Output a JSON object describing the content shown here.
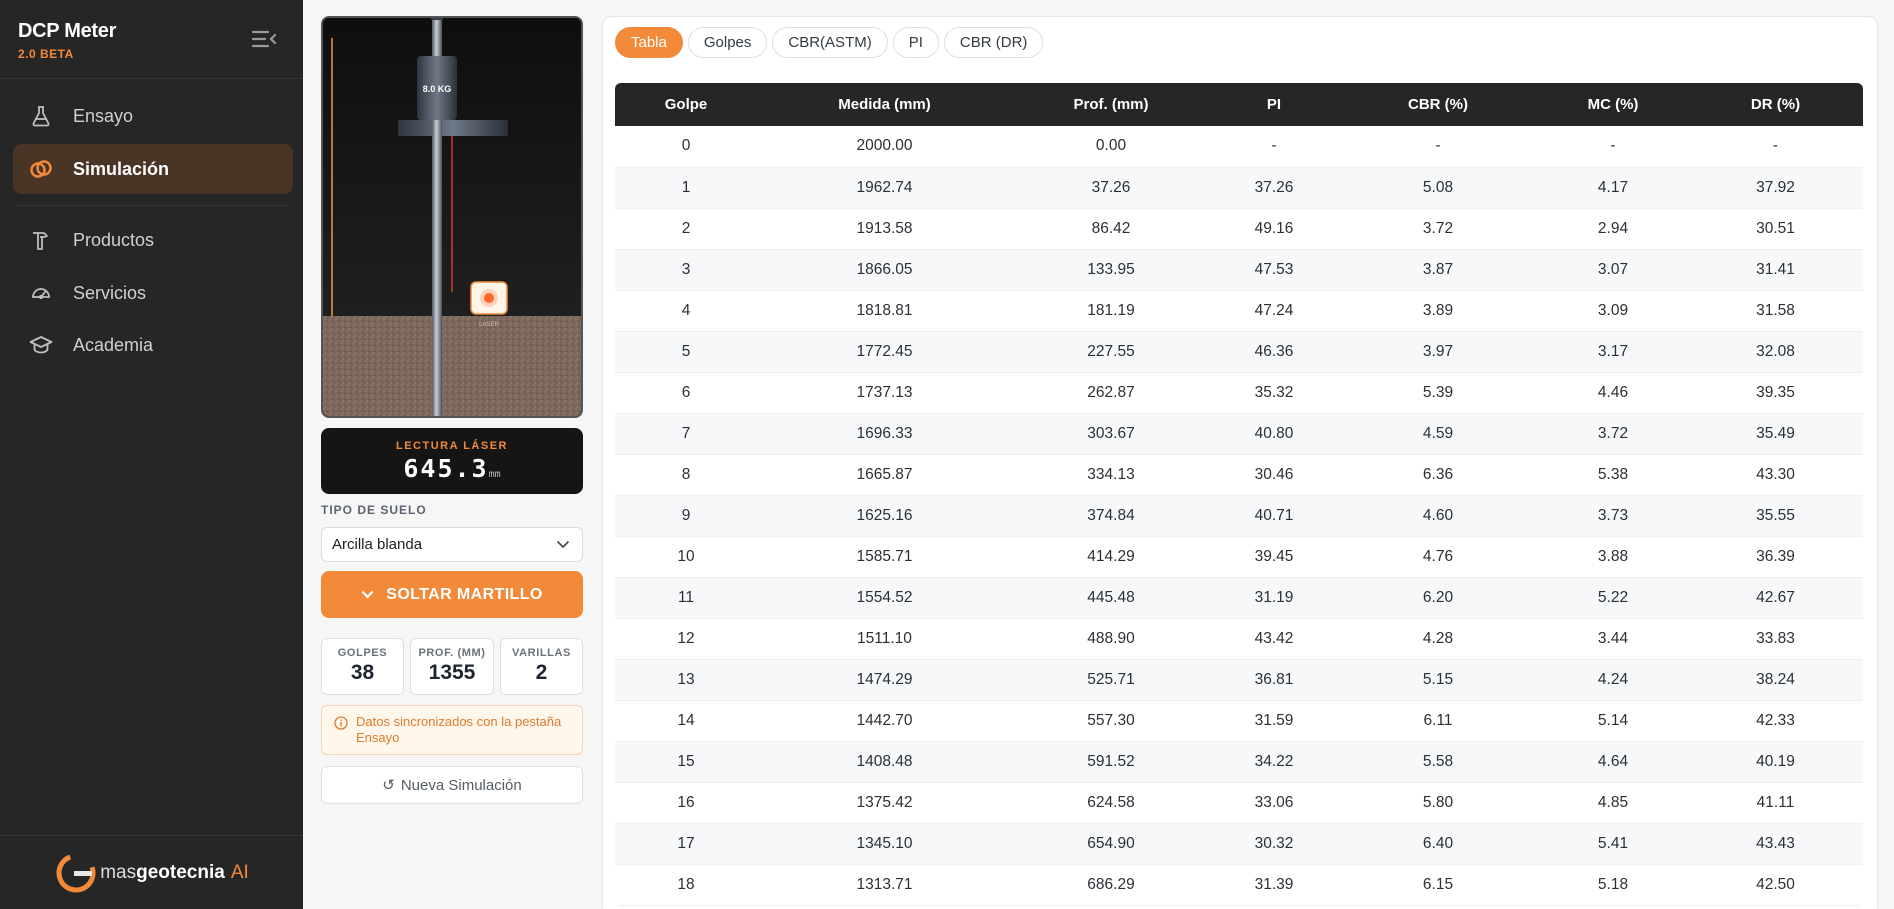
{
  "app": {
    "title": "DCP Meter",
    "version": "2.0 BETA",
    "accent_color": "#f28a3a"
  },
  "sidebar": {
    "items": [
      {
        "label": "Ensayo",
        "icon": "flask-icon",
        "active": false
      },
      {
        "label": "Simulación",
        "icon": "rings-icon",
        "active": true
      },
      {
        "label": "Productos",
        "icon": "hammer-icon",
        "active": false
      },
      {
        "label": "Servicios",
        "icon": "gauge-icon",
        "active": false
      },
      {
        "label": "Academia",
        "icon": "graduation-cap-icon",
        "active": false
      }
    ],
    "footer": {
      "logo_prefix": "mas",
      "logo_bold": "geotecnia",
      "logo_suffix": "AI"
    }
  },
  "simulation": {
    "hammer_weight": "8.0 KG",
    "laser_tag": "LASER",
    "laser_reading_label": "LECTURA LÁSER",
    "laser_reading_value": "645.3",
    "laser_reading_unit": "mm",
    "soil_type_label": "TIPO DE SUELO",
    "soil_type_value": "Arcilla blanda",
    "drop_button_label": "SOLTAR MARTILLO",
    "stats": {
      "blows_label": "GOLPES",
      "blows_value": "38",
      "depth_label": "PROF. (MM)",
      "depth_value": "1355",
      "rods_label": "VARILLAS",
      "rods_value": "2"
    },
    "sync_note": "Datos sincronizados con la pestaña Ensayo",
    "new_sim_label": "Nueva Simulación"
  },
  "data_view": {
    "tabs": [
      {
        "label": "Tabla",
        "active": true
      },
      {
        "label": "Golpes",
        "active": false
      },
      {
        "label": "CBR(ASTM)",
        "active": false
      },
      {
        "label": "PI",
        "active": false
      },
      {
        "label": "CBR (DR)",
        "active": false
      }
    ],
    "columns": [
      "Golpe",
      "Medida (mm)",
      "Prof. (mm)",
      "PI",
      "CBR (%)",
      "MC (%)",
      "DR (%)"
    ],
    "rows": [
      [
        "0",
        "2000.00",
        "0.00",
        "-",
        "-",
        "-",
        "-"
      ],
      [
        "1",
        "1962.74",
        "37.26",
        "37.26",
        "5.08",
        "4.17",
        "37.92"
      ],
      [
        "2",
        "1913.58",
        "86.42",
        "49.16",
        "3.72",
        "2.94",
        "30.51"
      ],
      [
        "3",
        "1866.05",
        "133.95",
        "47.53",
        "3.87",
        "3.07",
        "31.41"
      ],
      [
        "4",
        "1818.81",
        "181.19",
        "47.24",
        "3.89",
        "3.09",
        "31.58"
      ],
      [
        "5",
        "1772.45",
        "227.55",
        "46.36",
        "3.97",
        "3.17",
        "32.08"
      ],
      [
        "6",
        "1737.13",
        "262.87",
        "35.32",
        "5.39",
        "4.46",
        "39.35"
      ],
      [
        "7",
        "1696.33",
        "303.67",
        "40.80",
        "4.59",
        "3.72",
        "35.49"
      ],
      [
        "8",
        "1665.87",
        "334.13",
        "30.46",
        "6.36",
        "5.38",
        "43.30"
      ],
      [
        "9",
        "1625.16",
        "374.84",
        "40.71",
        "4.60",
        "3.73",
        "35.55"
      ],
      [
        "10",
        "1585.71",
        "414.29",
        "39.45",
        "4.76",
        "3.88",
        "36.39"
      ],
      [
        "11",
        "1554.52",
        "445.48",
        "31.19",
        "6.20",
        "5.22",
        "42.67"
      ],
      [
        "12",
        "1511.10",
        "488.90",
        "43.42",
        "4.28",
        "3.44",
        "33.83"
      ],
      [
        "13",
        "1474.29",
        "525.71",
        "36.81",
        "5.15",
        "4.24",
        "38.24"
      ],
      [
        "14",
        "1442.70",
        "557.30",
        "31.59",
        "6.11",
        "5.14",
        "42.33"
      ],
      [
        "15",
        "1408.48",
        "591.52",
        "34.22",
        "5.58",
        "4.64",
        "40.19"
      ],
      [
        "16",
        "1375.42",
        "624.58",
        "33.06",
        "5.80",
        "4.85",
        "41.11"
      ],
      [
        "17",
        "1345.10",
        "654.90",
        "30.32",
        "6.40",
        "5.41",
        "43.43"
      ],
      [
        "18",
        "1313.71",
        "686.29",
        "31.39",
        "6.15",
        "5.18",
        "42.50"
      ]
    ]
  }
}
